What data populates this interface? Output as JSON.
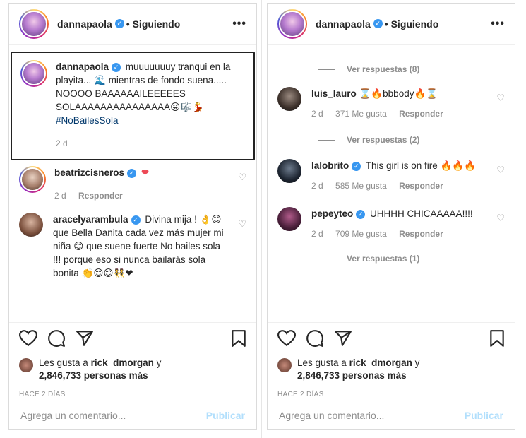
{
  "left": {
    "header": {
      "username": "dannapaola",
      "follow_status": "• Siguiendo",
      "more": "•••"
    },
    "caption": {
      "username": "dannapaola",
      "text": "muuuuuuuy tranqui en la playita... 🌊 mientras de fondo suena..... NOOOO BAAAAAAILEEEEES SOLAAAAAAAAAAAAAAA😛🎼💃",
      "hashtag": "#NoBailesSola",
      "time": "2 d"
    },
    "comments": [
      {
        "username": "beatrizcisneros",
        "text": "❤",
        "time": "2 d",
        "reply": "Responder"
      },
      {
        "username": "aracelyarambula",
        "text": "Divina mija ! 👌😊 que Bella Danita cada vez más mujer mi niña 😊 que suene fuerte No bailes sola !!! porque eso si nunca bailarás sola bonita 👏😊😊👯❤"
      }
    ],
    "likes": {
      "prefix": "Les gusta a",
      "user": "rick_dmorgan",
      "suffix": "y",
      "count": "2,846,733 personas más"
    },
    "post_time": "HACE 2 DÍAS",
    "add_comment": {
      "placeholder": "Agrega un comentario...",
      "publish": "Publicar"
    }
  },
  "right": {
    "header": {
      "username": "dannapaola",
      "follow_status": "• Siguiendo",
      "more": "•••"
    },
    "view_replies_top": "Ver respuestas (8)",
    "comments": [
      {
        "username": "luis_lauro",
        "text": "⌛🔥bbbody🔥⌛",
        "time": "2 d",
        "likes": "371 Me gusta",
        "reply": "Responder",
        "view_replies": "Ver respuestas (2)"
      },
      {
        "username": "lalobrito",
        "text": "This girl is on fire 🔥🔥🔥",
        "time": "2 d",
        "likes": "585 Me gusta",
        "reply": "Responder"
      },
      {
        "username": "pepeyteo",
        "text": "UHHHH CHICAAAAA!!!!",
        "time": "2 d",
        "likes": "709 Me gusta",
        "reply": "Responder",
        "view_replies": "Ver respuestas (1)"
      }
    ],
    "likes": {
      "prefix": "Les gusta a",
      "user": "rick_dmorgan",
      "suffix": "y",
      "count": "2,846,733 personas más"
    },
    "post_time": "HACE 2 DÍAS",
    "add_comment": {
      "placeholder": "Agrega un comentario...",
      "publish": "Publicar"
    }
  },
  "colors": {
    "verified": "#3897f0",
    "publish": "#b2dffc",
    "hashtag": "#00376b",
    "heart_red": "#ed4956"
  },
  "icons": [
    "heart-icon",
    "comment-icon",
    "share-icon",
    "bookmark-icon",
    "verified-icon",
    "more-icon"
  ]
}
